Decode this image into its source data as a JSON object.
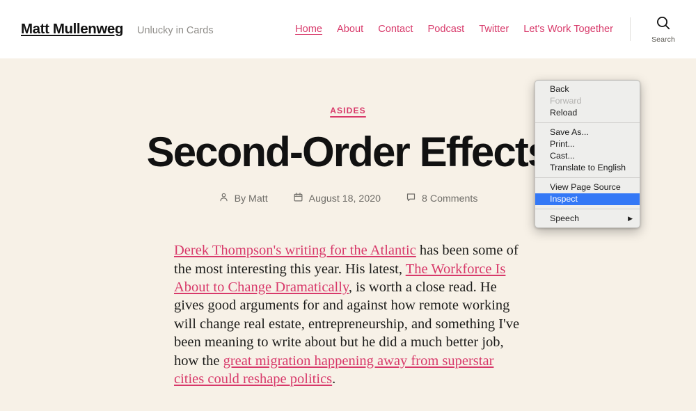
{
  "header": {
    "site_title": "Matt Mullenweg",
    "tagline": "Unlucky in Cards",
    "nav": [
      {
        "label": "Home",
        "current": true
      },
      {
        "label": "About",
        "current": false
      },
      {
        "label": "Contact",
        "current": false
      },
      {
        "label": "Podcast",
        "current": false
      },
      {
        "label": "Twitter",
        "current": false
      },
      {
        "label": "Let's Work Together",
        "current": false
      }
    ],
    "search": {
      "icon": "search-icon",
      "label": "Search"
    }
  },
  "article": {
    "category": "ASIDES",
    "title": "Second-Order Effects",
    "meta": {
      "author_icon": "person-icon",
      "author": "By Matt",
      "date_icon": "calendar-icon",
      "date": "August 18, 2020",
      "comments_icon": "comment-icon",
      "comments": "8 Comments"
    },
    "body": {
      "link1": "Derek Thompson's writing for the Atlantic",
      "text1": " has been some of the most interesting this year. His latest, ",
      "link2": "The Workforce Is About to Change Dramatically",
      "text2": ", is worth a close read. He gives good arguments for and against how remote working will change real estate, entrepreneurship, and something I've been meaning to write about but he did a much better job, how the ",
      "link3": "great migration happening away from superstar cities could reshape politics",
      "text3": "."
    }
  },
  "context_menu": {
    "groups": [
      [
        {
          "label": "Back",
          "state": "normal"
        },
        {
          "label": "Forward",
          "state": "disabled"
        },
        {
          "label": "Reload",
          "state": "normal"
        }
      ],
      [
        {
          "label": "Save As...",
          "state": "normal"
        },
        {
          "label": "Print...",
          "state": "normal"
        },
        {
          "label": "Cast...",
          "state": "normal"
        },
        {
          "label": "Translate to English",
          "state": "normal"
        }
      ],
      [
        {
          "label": "View Page Source",
          "state": "normal"
        },
        {
          "label": "Inspect",
          "state": "selected"
        }
      ],
      [
        {
          "label": "Speech",
          "state": "normal",
          "submenu": true,
          "submenu_arrow": "▶"
        }
      ]
    ]
  },
  "colors": {
    "accent": "#d8396a",
    "page_background": "#f7f1e7",
    "header_background": "#ffffff",
    "menu_highlight": "#3478f6",
    "text": "#111111"
  }
}
